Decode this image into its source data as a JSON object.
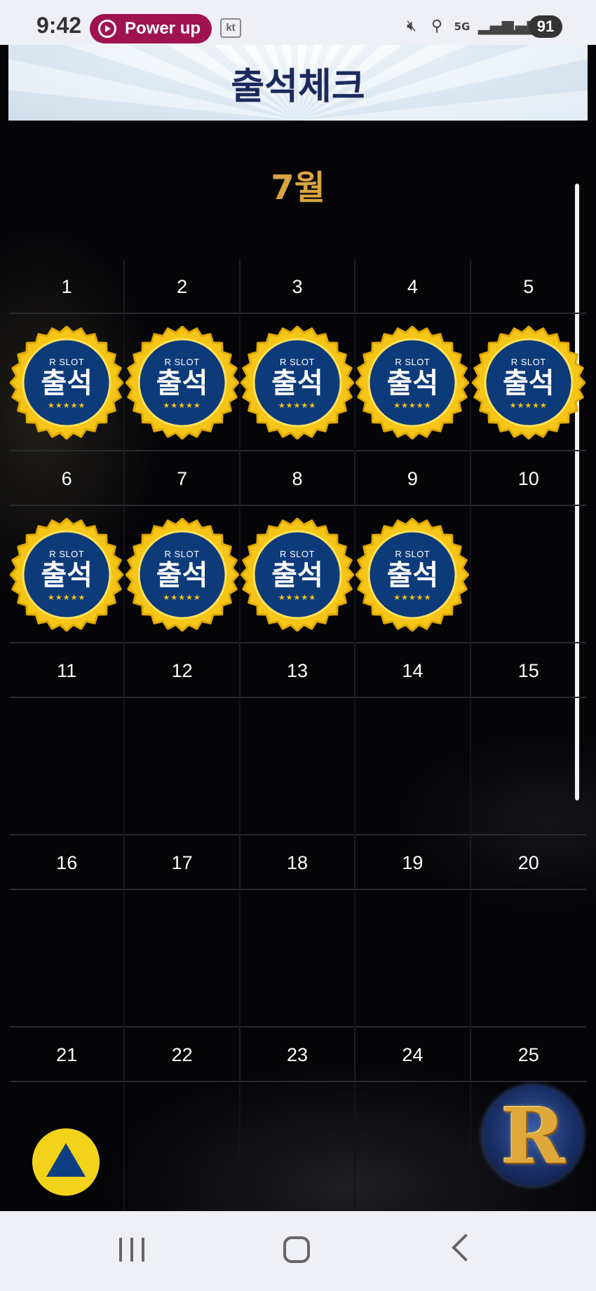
{
  "status_bar": {
    "time": "9:42",
    "pill_label": "Power up",
    "carrier": "kt",
    "network": "5G",
    "battery": "91"
  },
  "header": {
    "title": "출석체크"
  },
  "calendar": {
    "month": "7월",
    "badge": {
      "brand": "R SLOT",
      "word": "출석",
      "stars": "★★★★★"
    },
    "weeks": [
      {
        "days": [
          "1",
          "2",
          "3",
          "4",
          "5"
        ],
        "checked": [
          true,
          true,
          true,
          true,
          true
        ]
      },
      {
        "days": [
          "6",
          "7",
          "8",
          "9",
          "10"
        ],
        "checked": [
          true,
          true,
          true,
          true,
          false
        ]
      },
      {
        "days": [
          "11",
          "12",
          "13",
          "14",
          "15"
        ],
        "checked": [
          false,
          false,
          false,
          false,
          false
        ]
      },
      {
        "days": [
          "16",
          "17",
          "18",
          "19",
          "20"
        ],
        "checked": [
          false,
          false,
          false,
          false,
          false
        ]
      },
      {
        "days": [
          "21",
          "22",
          "23",
          "24",
          "25"
        ],
        "checked": [
          false,
          false,
          false,
          false,
          false
        ]
      }
    ]
  },
  "floating": {
    "logo_letter": "R"
  },
  "colors": {
    "month": "#d9a441",
    "badge_fill": "#0d3b7a",
    "badge_ring": "#f5c518"
  }
}
